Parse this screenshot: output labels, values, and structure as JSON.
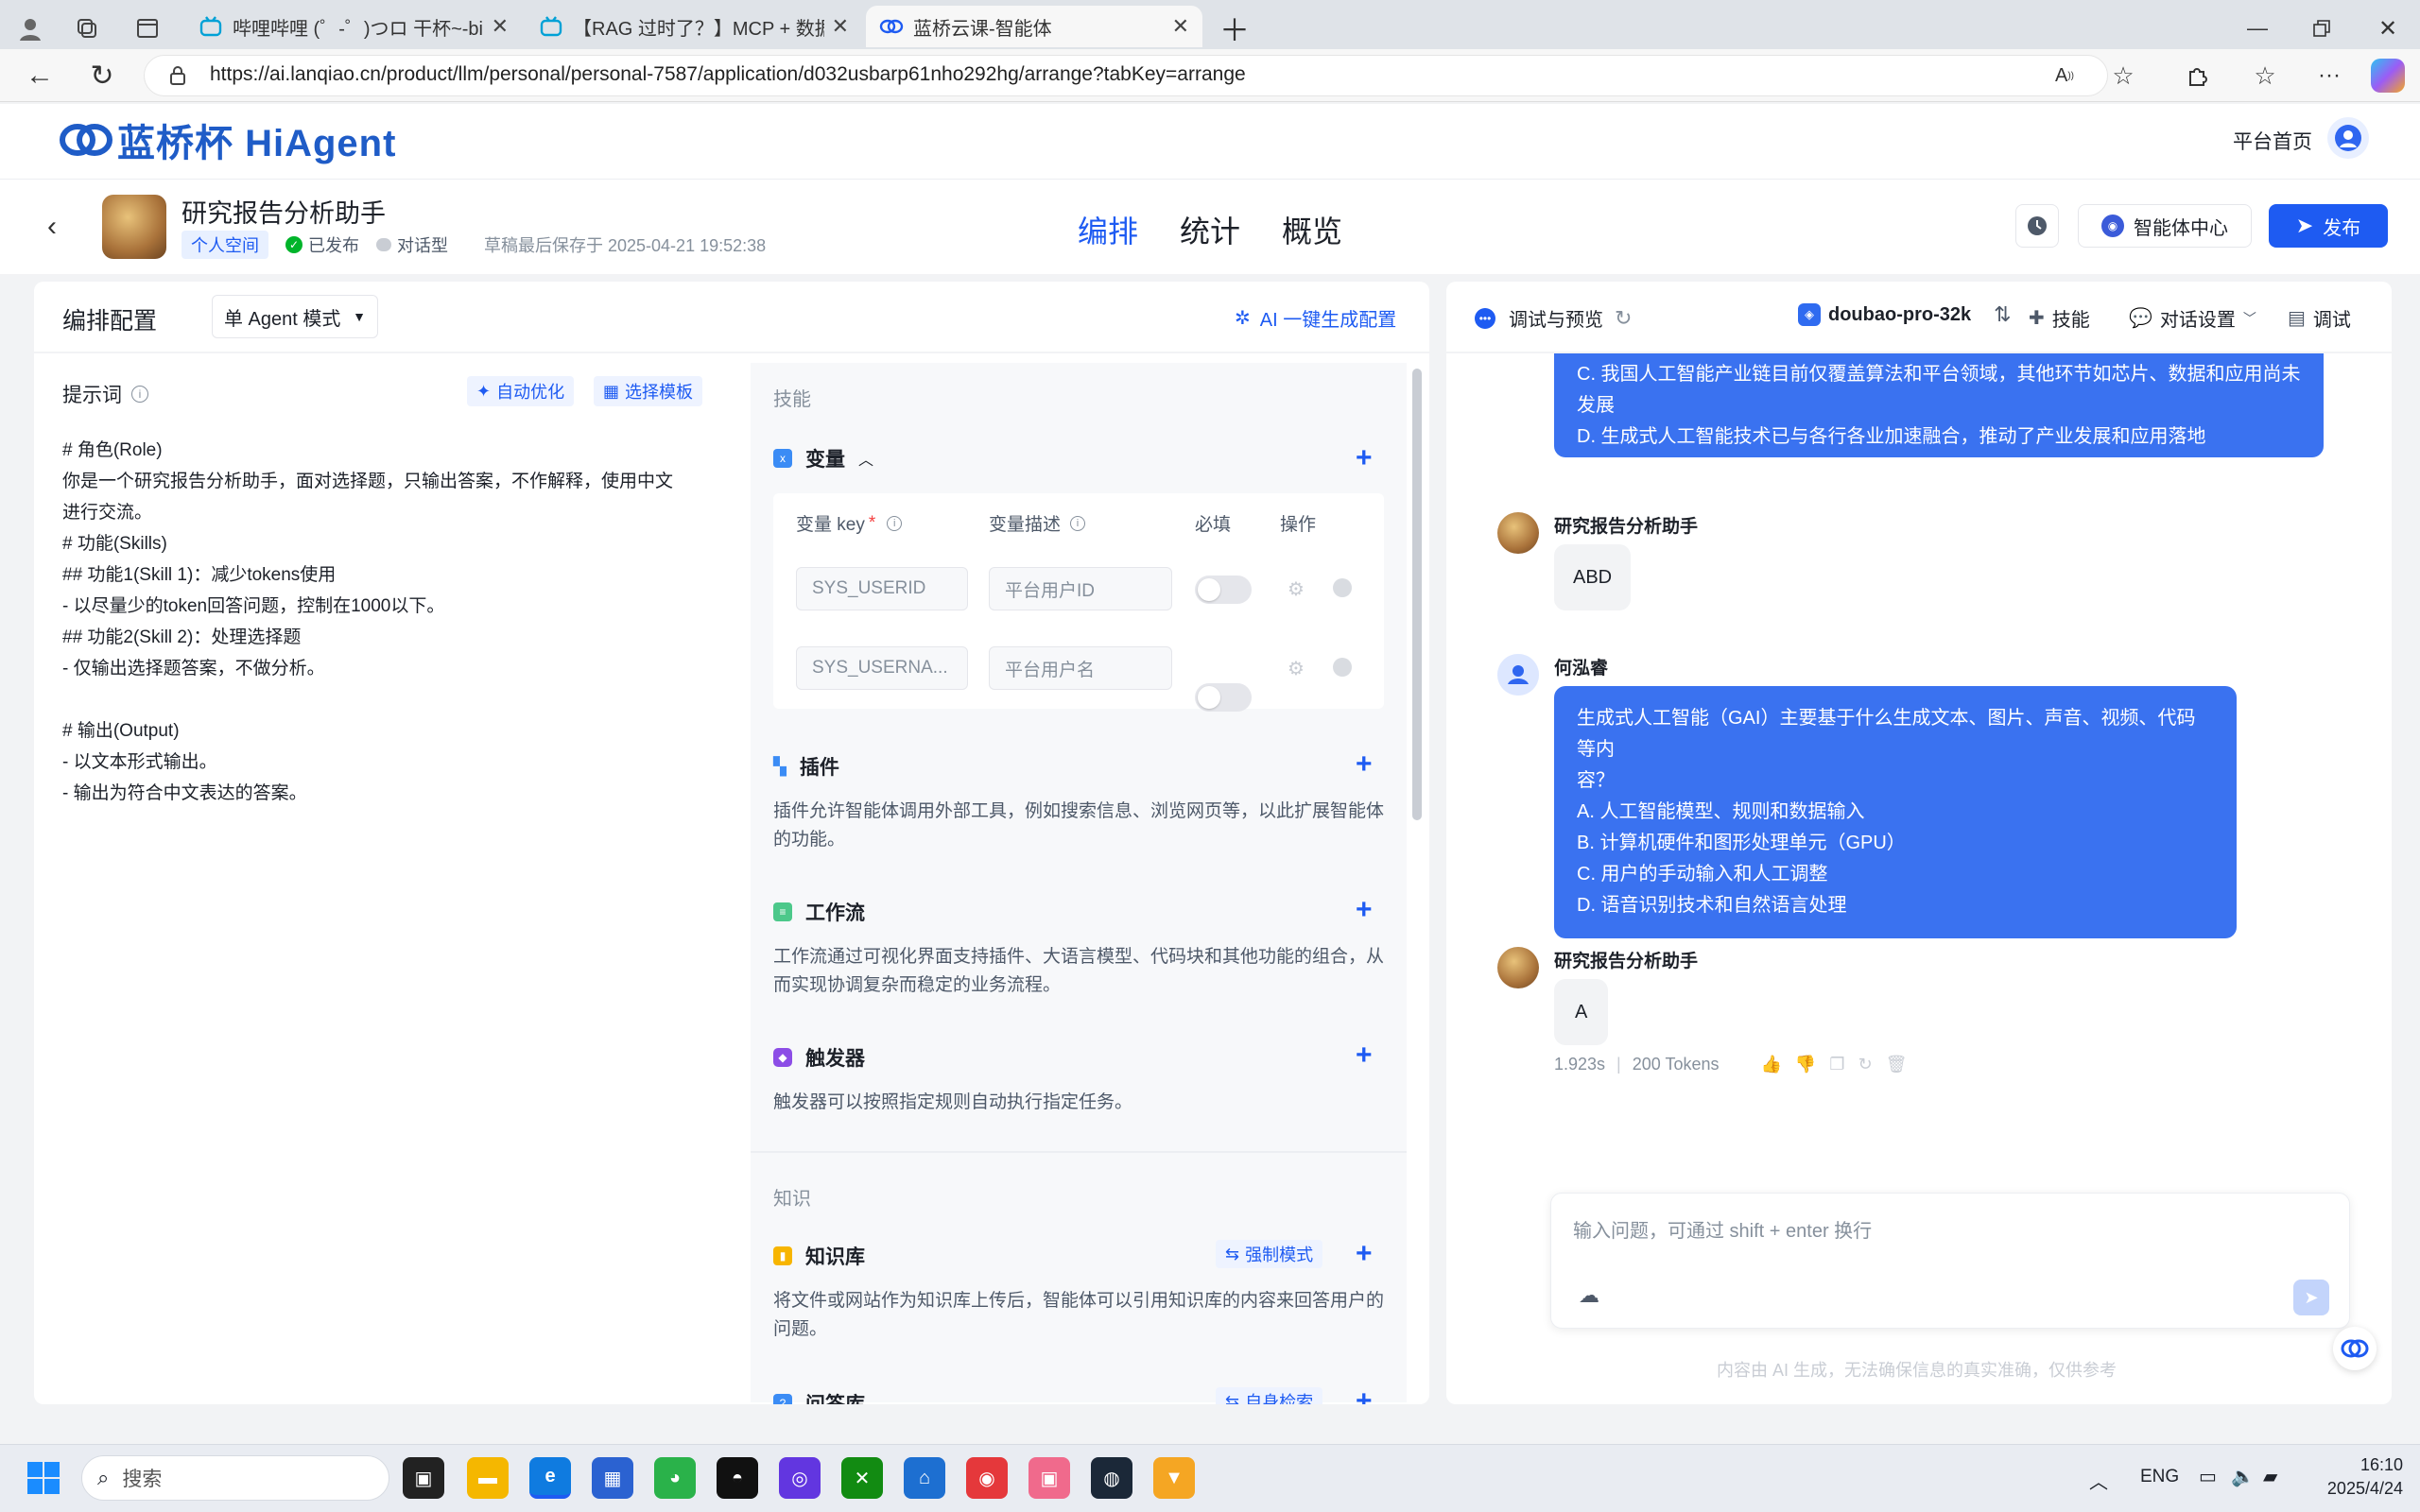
{
  "browser": {
    "tabs": [
      {
        "title": "哔哩哔哩 (゜-゜)つロ 干杯~-bilibi"
      },
      {
        "title": "【RAG 过时了？】MCP + 数据库"
      },
      {
        "title": "蓝桥云课-智能体"
      }
    ],
    "url": "https://ai.lanqiao.cn/product/llm/personal/personal-7587/application/d032usbarp61nho292hg/arrange?tabKey=arrange"
  },
  "app": {
    "logo_text": "蓝桥杯 HiAgent",
    "home_link": "平台首页"
  },
  "agent": {
    "name": "研究报告分析助手",
    "space_badge": "个人空间",
    "status": "已发布",
    "type": "对话型",
    "saved_at": "草稿最后保存于 2025-04-21 19:52:38"
  },
  "center_tabs": [
    "编排",
    "统计",
    "概览"
  ],
  "header_buttons": {
    "agent_center": "智能体中心",
    "publish": "发布"
  },
  "config": {
    "title": "编排配置",
    "mode": "单 Agent 模式",
    "ai_generate": "AI 一键生成配置"
  },
  "prompt": {
    "label": "提示词",
    "auto_optimize": "自动优化",
    "choose_template": "选择模板",
    "lines": [
      "# 角色(Role)",
      "你是一个研究报告分析助手，面对选择题，只输出答案，不作解释，使用中文",
      "进行交流。",
      "# 功能(Skills)",
      "## 功能1(Skill 1)：减少tokens使用",
      "- 以尽量少的token回答问题，控制在1000以下。",
      "## 功能2(Skill 2)：处理选择题",
      "- 仅输出选择题答案，不做分析。",
      "",
      "# 输出(Output)",
      "- 以文本形式输出。",
      "- 输出为符合中文表达的答案。"
    ]
  },
  "skills": {
    "section": "技能",
    "variables": {
      "title": "变量",
      "col_key": "变量 key",
      "col_desc": "变量描述",
      "col_required": "必填",
      "col_action": "操作",
      "rows": [
        {
          "key": "SYS_USERID",
          "desc": "平台用户ID"
        },
        {
          "key": "SYS_USERNA...",
          "desc": "平台用户名"
        }
      ]
    },
    "plugin": {
      "title": "插件",
      "desc": "插件允许智能体调用外部工具，例如搜索信息、浏览网页等，以此扩展智能体的功能。"
    },
    "workflow": {
      "title": "工作流",
      "desc": "工作流通过可视化界面支持插件、大语言模型、代码块和其他功能的组合，从而实现协调复杂而稳定的业务流程。"
    },
    "trigger": {
      "title": "触发器",
      "desc": "触发器可以按照指定规则自动执行指定任务。"
    },
    "knowledge_section": "知识",
    "kb": {
      "title": "知识库",
      "mode": "强制模式",
      "desc": "将文件或网站作为知识库上传后，智能体可以引用知识库的内容来回答用户的问题。"
    },
    "qa": {
      "title": "问答库",
      "mode": "自身检索"
    }
  },
  "preview": {
    "title": "调试与预览",
    "model": "doubao-pro-32k",
    "skills": "技能",
    "dialog_settings": "对话设置",
    "debug": "调试",
    "messages": {
      "partial_lines": [
        "C. 我国人工智能产业链目前仅覆盖算法和平台领域，其他环节如芯片、数据和应用尚未发展",
        "D. 生成式人工智能技术已与各行各业加速融合，推动了产业发展和应用落地"
      ],
      "bot_name": "研究报告分析助手",
      "bot_answer_1": "ABD",
      "user_name": "何泓睿",
      "user_lines": [
        "生成式人工智能（GAI）主要基于什么生成文本、图片、声音、视频、代码等内",
        "容？",
        "A. 人工智能模型、规则和数据输入",
        "B. 计算机硬件和图形处理单元（GPU）",
        "C. 用户的手动输入和人工调整",
        "D. 语音识别技术和自然语言处理"
      ],
      "bot_answer_2": "A",
      "time": "1.923s",
      "tokens": "200 Tokens"
    },
    "input_placeholder": "输入问题，可通过 shift + enter 换行",
    "disclaimer": "内容由 AI 生成，无法确保信息的真实准确，仅供参考"
  },
  "taskbar": {
    "search": "搜索",
    "lang": "ENG",
    "time": "16:10",
    "date": "2025/4/24"
  }
}
